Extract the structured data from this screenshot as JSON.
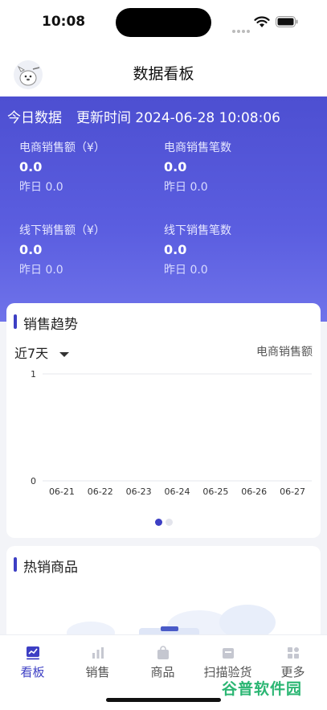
{
  "status": {
    "time": "10:08"
  },
  "header": {
    "title": "数据看板"
  },
  "today": {
    "title": "今日数据",
    "update_label": "更新时间",
    "update_time": "2024-06-28 10:08:06",
    "metrics": [
      {
        "label": "电商销售额（¥）",
        "value": "0.0",
        "yesterday": "昨日 0.0"
      },
      {
        "label": "电商销售笔数",
        "value": "0.0",
        "yesterday": "昨日 0.0"
      },
      {
        "label": "线下销售额（¥）",
        "value": "0.0",
        "yesterday": "昨日 0.0"
      },
      {
        "label": "线下销售笔数",
        "value": "0.0",
        "yesterday": "昨日 0.0"
      }
    ]
  },
  "trend": {
    "title": "销售趋势",
    "range": "近7天",
    "metric": "电商销售额",
    "chart_data": {
      "type": "line",
      "categories": [
        "06-21",
        "06-22",
        "06-23",
        "06-24",
        "06-25",
        "06-26",
        "06-27"
      ],
      "values": [
        0,
        0,
        0,
        0,
        0,
        0,
        0
      ],
      "yticks": [
        "1",
        "0"
      ],
      "ylim": [
        0,
        1
      ],
      "grid": true
    },
    "pager": {
      "pages": 2,
      "active": 0
    }
  },
  "hot": {
    "title": "热销商品"
  },
  "tabs": [
    {
      "label": "看板",
      "icon": "dashboard-icon",
      "active": true
    },
    {
      "label": "销售",
      "icon": "sales-chart-icon",
      "active": false
    },
    {
      "label": "商品",
      "icon": "shopping-bag-icon",
      "active": false
    },
    {
      "label": "扫描验货",
      "icon": "scan-box-icon",
      "active": false
    },
    {
      "label": "更多",
      "icon": "more-grid-icon",
      "active": false
    }
  ],
  "watermark": "谷普软件园",
  "colors": {
    "primary": "#3d3fc4",
    "hero": "#5558dc"
  }
}
